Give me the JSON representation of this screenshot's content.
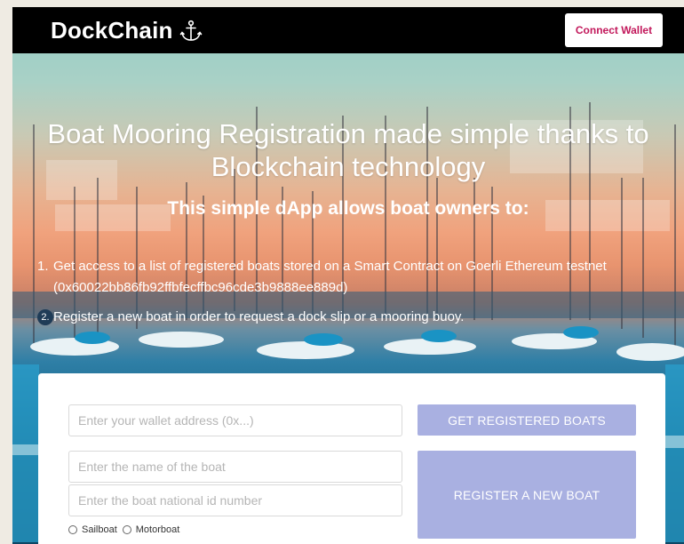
{
  "header": {
    "logo_text": "DockChain",
    "logo_icon": "anchor-icon",
    "connect_label": "Connect Wallet"
  },
  "hero": {
    "title": "Boat Mooring Registration made simple thanks to Blockchain technology",
    "subtitle": "This simple dApp allows boat owners to:",
    "items": [
      {
        "num": "1.",
        "text": "Get access to a list of registered boats stored on a Smart Contract on Goerli Ethereum testnet (0x60022bb86fb92ffbfecffbc96cde3b9888ee889d)"
      },
      {
        "num": "2.",
        "text": "Register a new boat in order to request a dock slip or a mooring buoy."
      }
    ]
  },
  "form": {
    "wallet_placeholder": "Enter your wallet address (0x...)",
    "get_boats_label": "GET REGISTERED BOATS",
    "boat_name_placeholder": "Enter the name of the boat",
    "boat_id_placeholder": "Enter the boat national id number",
    "register_label": "REGISTER A NEW BOAT",
    "boat_types": [
      "Sailboat",
      "Motorboat"
    ]
  },
  "colors": {
    "topbar": "#000000",
    "connect_text": "#c2185b",
    "button_bg": "#a9b0e1"
  }
}
